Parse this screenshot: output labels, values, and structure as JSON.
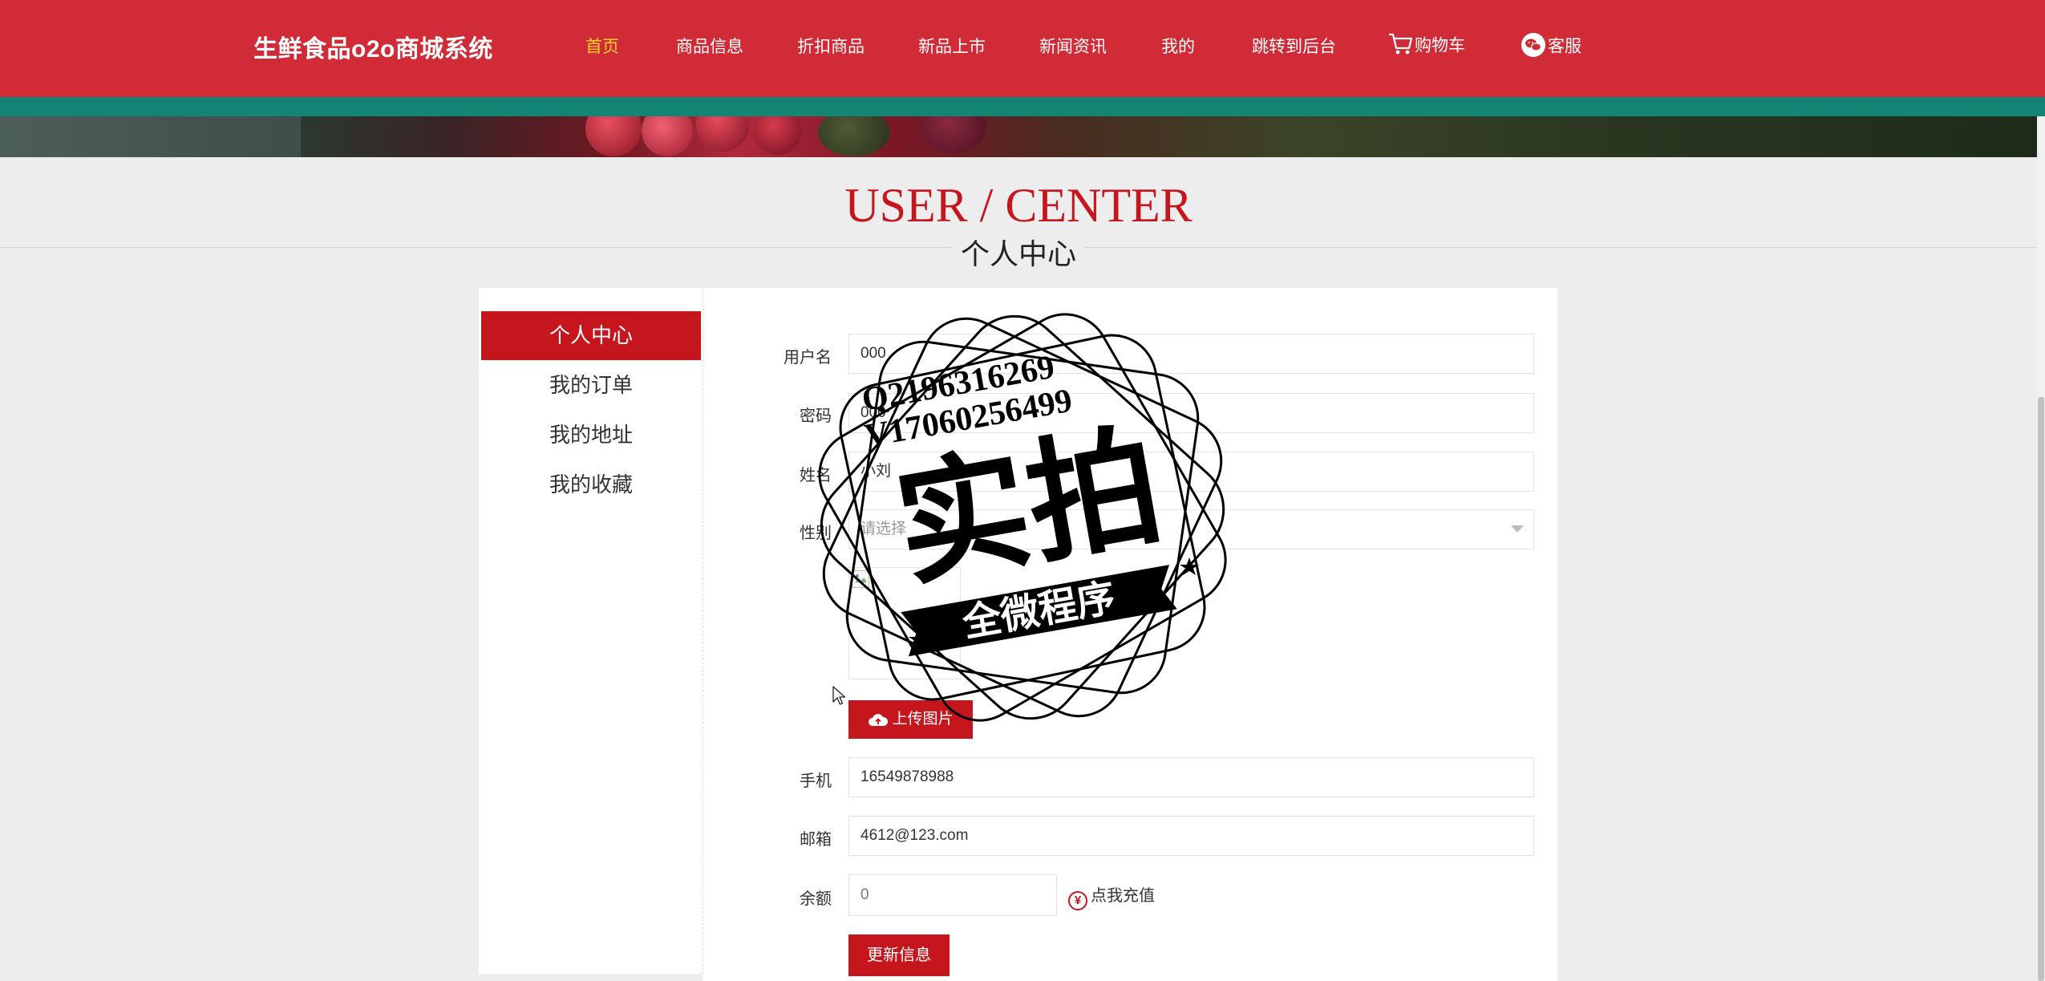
{
  "header": {
    "brand": "生鲜食品o2o商城系统",
    "nav": [
      {
        "label": "首页",
        "active": true
      },
      {
        "label": "商品信息"
      },
      {
        "label": "折扣商品"
      },
      {
        "label": "新品上市"
      },
      {
        "label": "新闻资讯"
      },
      {
        "label": "我的"
      },
      {
        "label": "跳转到后台"
      },
      {
        "label": "购物车",
        "icon": "cart-icon"
      },
      {
        "label": "客服",
        "icon": "wechat-icon"
      }
    ],
    "colors": {
      "bar": "#d12b37",
      "band": "#128574",
      "active_nav": "#ffd32a"
    }
  },
  "page": {
    "title_en": "USER / CENTER",
    "title_cn": "个人中心"
  },
  "sidebar": {
    "items": [
      {
        "label": "个人中心",
        "active": true
      },
      {
        "label": "我的订单"
      },
      {
        "label": "我的地址"
      },
      {
        "label": "我的收藏"
      }
    ]
  },
  "form": {
    "username": {
      "label": "用户名",
      "value": "000"
    },
    "password": {
      "label": "密码",
      "value": "000"
    },
    "name": {
      "label": "姓名",
      "value": "小刘"
    },
    "gender": {
      "label": "性别",
      "placeholder": "请选择"
    },
    "upload_label": "上传图片",
    "phone": {
      "label": "手机",
      "value": "16549878988"
    },
    "email": {
      "label": "邮箱",
      "value": "4612@123.com"
    },
    "balance": {
      "label": "余额",
      "value": "0"
    },
    "recharge_label": "点我充值",
    "update_label": "更新信息",
    "accent": "#c5161d"
  },
  "watermark": {
    "line1": "Q2196316269",
    "line2": "V17060256499",
    "big": "实拍",
    "ribbon": "全微程序"
  }
}
